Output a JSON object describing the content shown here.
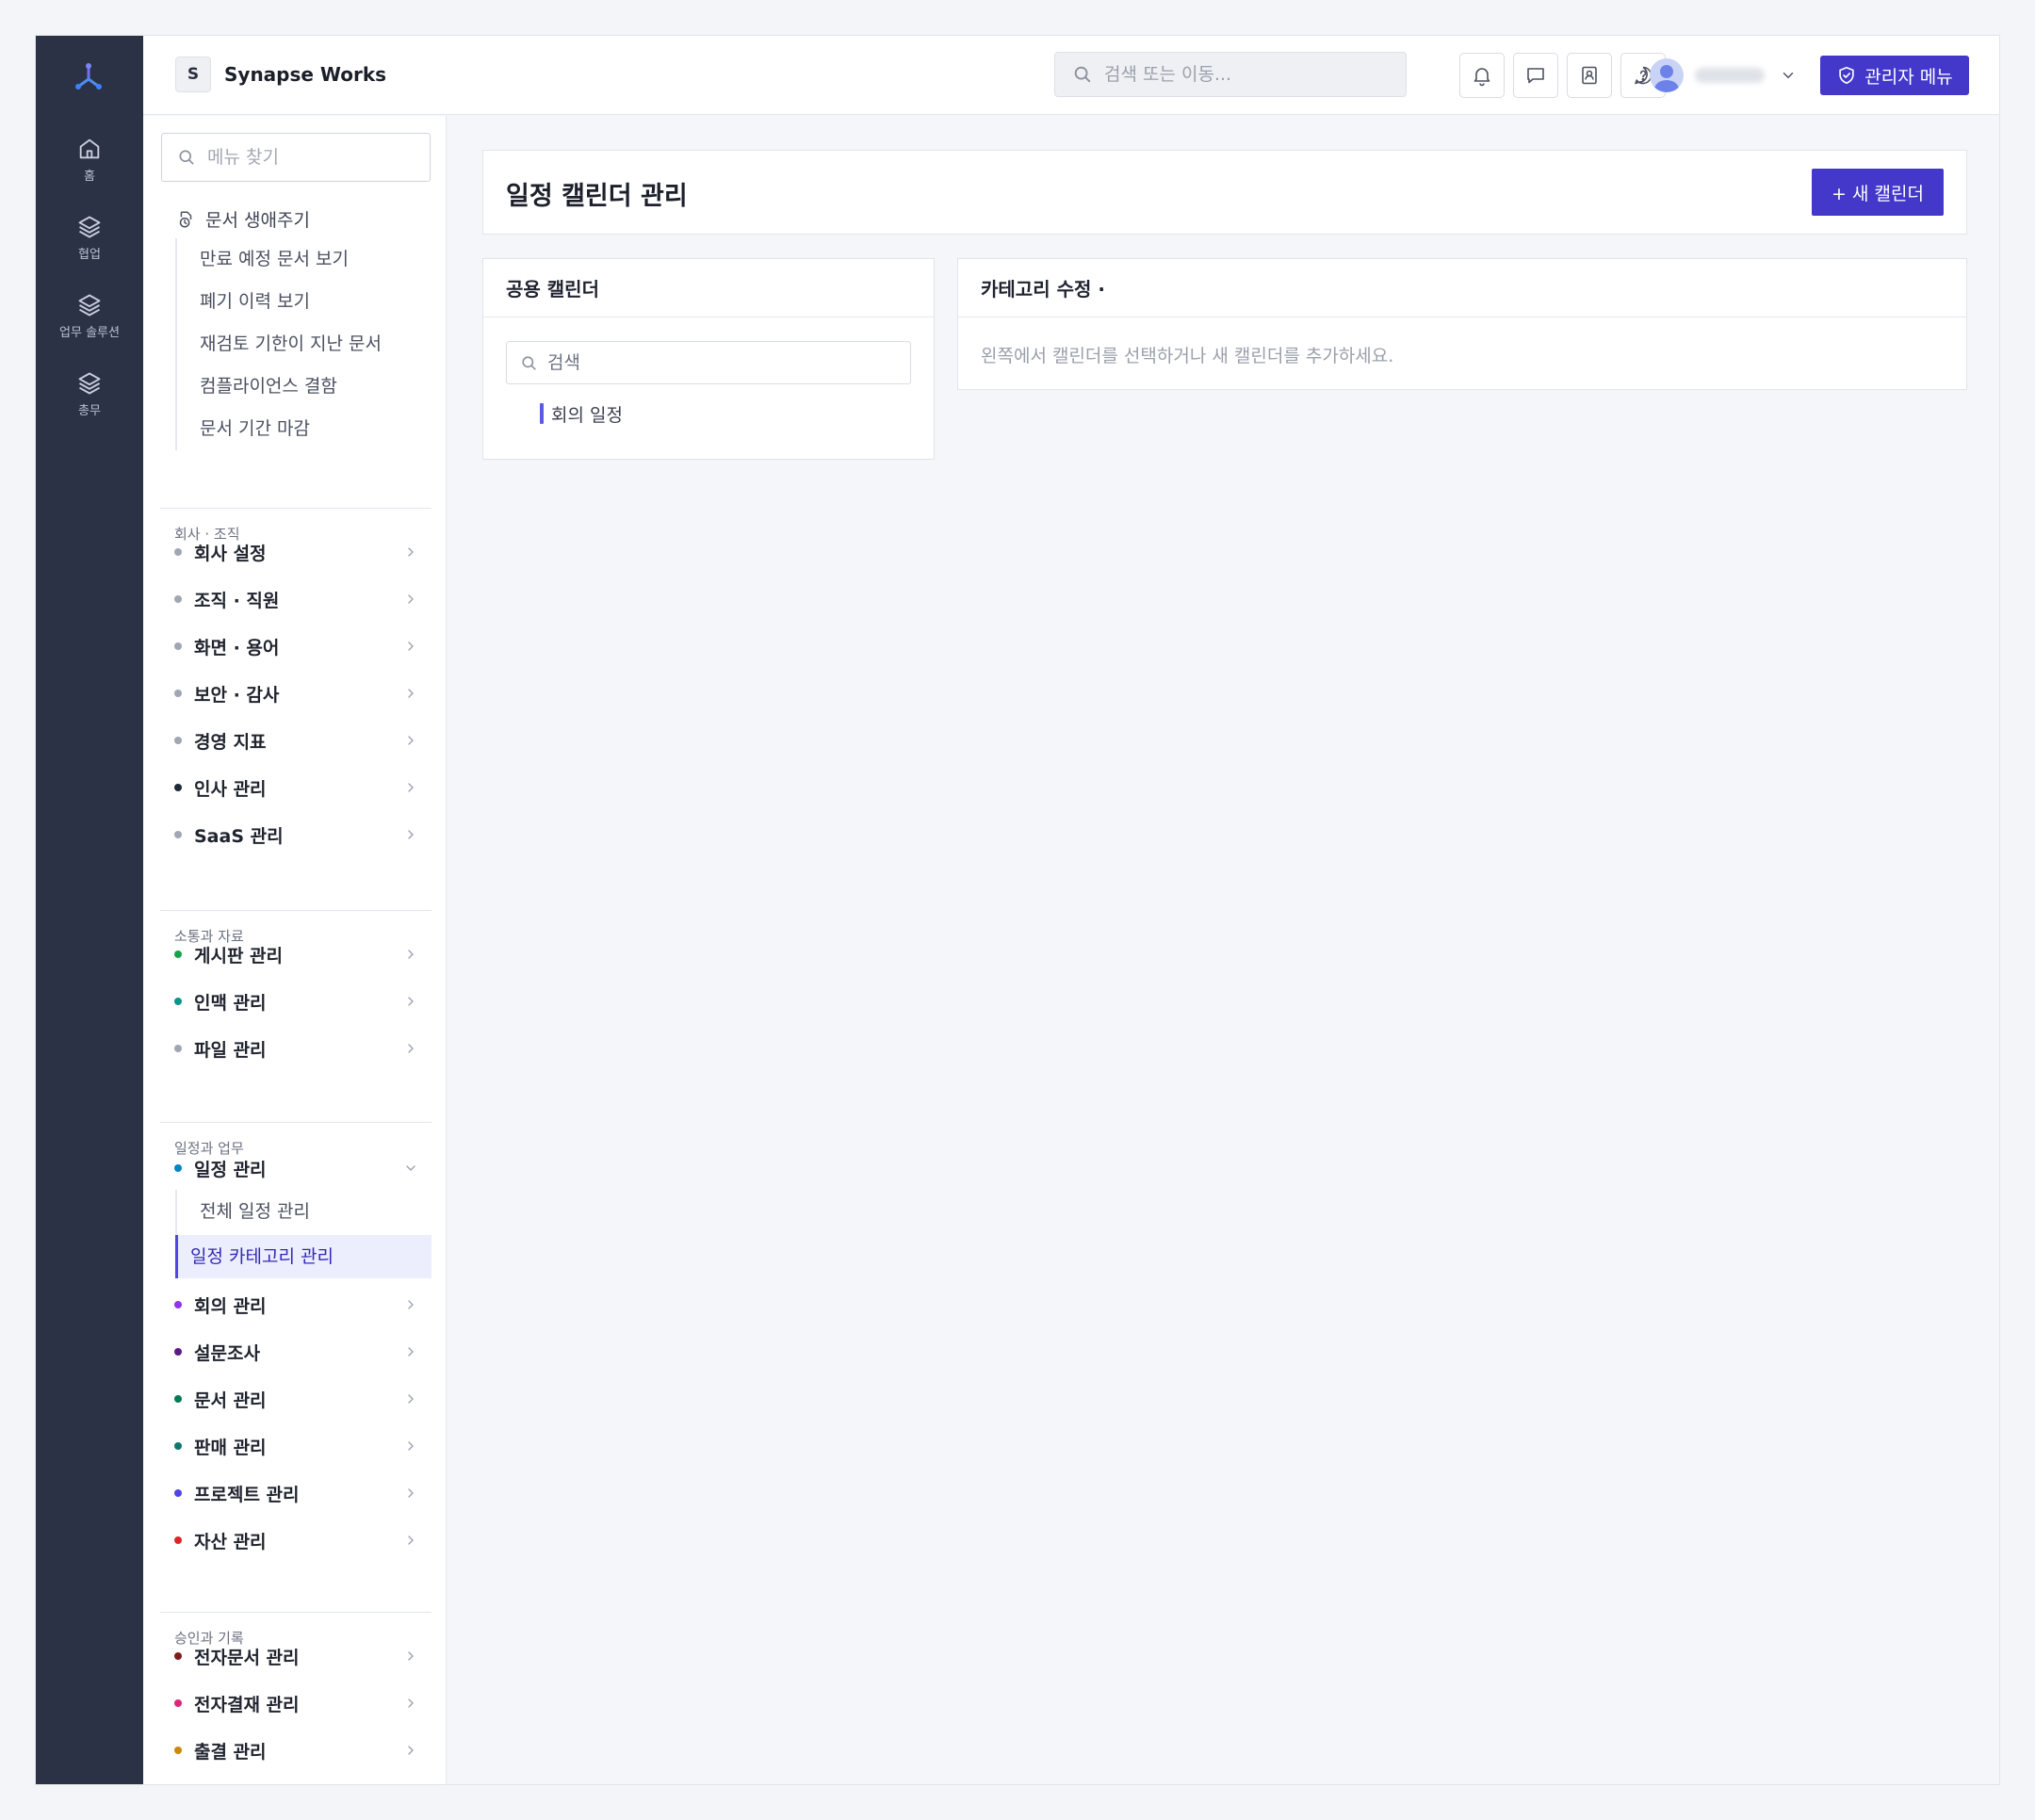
{
  "app": {
    "brand_initial": "S",
    "brand_name": "Synapse Works"
  },
  "rail": {
    "items": [
      {
        "label": "홈",
        "icon": "home-icon"
      },
      {
        "label": "협업",
        "icon": "layers-icon"
      },
      {
        "label": "업무 솔루션",
        "icon": "layers-icon"
      },
      {
        "label": "총무",
        "icon": "layers-icon"
      }
    ]
  },
  "header": {
    "search_placeholder": "검색 또는 이동...",
    "icons": [
      "bell-icon",
      "message-icon",
      "contact-book-icon",
      "help-icon"
    ],
    "admin_label": "관리자 메뉴"
  },
  "sidebar": {
    "search_placeholder": "메뉴 찾기",
    "lifecycle_label": "문서 생애주기",
    "lifecycle_items": [
      "만료 예정 문서 보기",
      "폐기 이력 보기",
      "재검토 기한이 지난 문서",
      "컴플라이언스 결함",
      "문서 기간 마감"
    ],
    "sections": [
      {
        "title": "회사 · 조직",
        "items": [
          {
            "label": "회사 설정",
            "color": "#a0a6b2"
          },
          {
            "label": "조직 · 직원",
            "color": "#a0a6b2"
          },
          {
            "label": "화면 · 용어",
            "color": "#a0a6b2"
          },
          {
            "label": "보안 · 감사",
            "color": "#a0a6b2"
          },
          {
            "label": "경영 지표",
            "color": "#a0a6b2"
          },
          {
            "label": "인사 관리",
            "color": "#1f2937"
          },
          {
            "label": "SaaS 관리",
            "color": "#a0a6b2"
          }
        ]
      },
      {
        "title": "소통과 자료",
        "items": [
          {
            "label": "게시판 관리",
            "color": "#16a34a"
          },
          {
            "label": "인맥 관리",
            "color": "#0d9488"
          },
          {
            "label": "파일 관리",
            "color": "#a0a6b2"
          }
        ]
      },
      {
        "title": "일정과 업무",
        "items": [
          {
            "label": "일정 관리",
            "color": "#0284c7"
          },
          {
            "label": "회의 관리",
            "color": "#9333ea"
          },
          {
            "label": "설문조사",
            "color": "#581c87"
          },
          {
            "label": "문서 관리",
            "color": "#047857"
          },
          {
            "label": "판매 관리",
            "color": "#0f766e"
          },
          {
            "label": "프로젝트 관리",
            "color": "#4f46e5"
          },
          {
            "label": "자산 관리",
            "color": "#dc2626"
          }
        ]
      },
      {
        "title": "승인과 기록",
        "items": [
          {
            "label": "전자문서 관리",
            "color": "#7f1d1d"
          },
          {
            "label": "전자결재 관리",
            "color": "#db2777"
          },
          {
            "label": "출결 관리",
            "color": "#ca8a04"
          }
        ]
      }
    ],
    "schedule_sub": [
      "전체 일정 관리",
      "일정 카테고리 관리"
    ]
  },
  "main": {
    "title": "일정 캘린더 관리",
    "new_button": "+ 새 캘린더",
    "calendar_panel": {
      "title": "공용 캘린더",
      "search_placeholder": "검색",
      "items": [
        "회의 일정"
      ]
    },
    "category_panel": {
      "title": "카테고리 수정 ·",
      "empty_message": "왼쪽에서 캘린더를 선택하거나 새 캘린더를 추가하세요."
    }
  },
  "colors": {
    "accent": "#4338ca",
    "rail_bg": "#2b3245",
    "active_bg": "#eceefd"
  }
}
